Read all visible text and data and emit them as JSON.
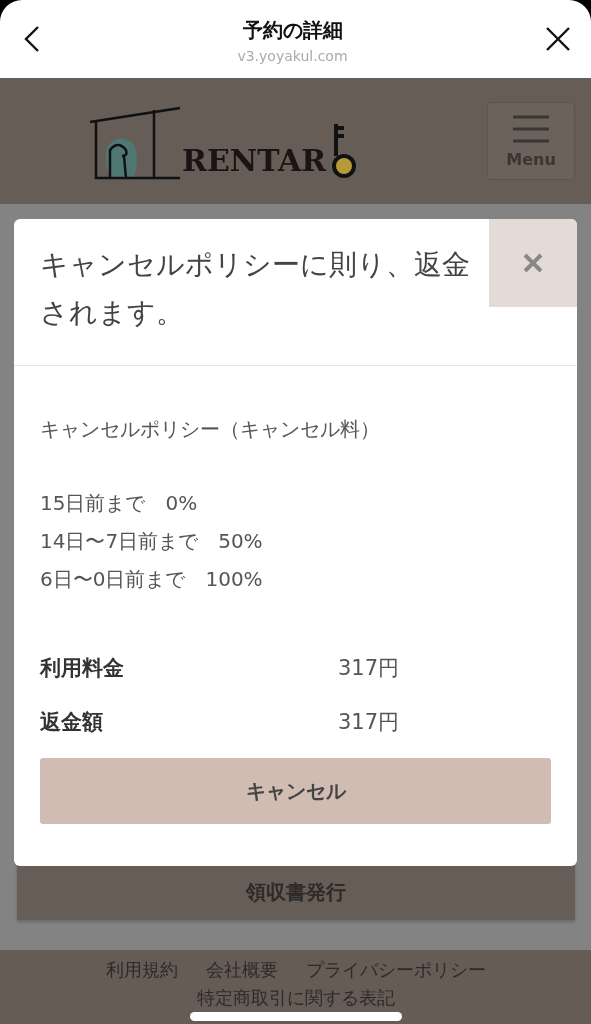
{
  "browser": {
    "title": "予約の詳細",
    "url": "v3.yoyakul.com"
  },
  "site_header": {
    "logo_text": "RENTAR",
    "menu_label": "Menu"
  },
  "modal": {
    "title": "キャンセルポリシーに則り、返金されます。",
    "policy_heading": "キャンセルポリシー（キャンセル料）",
    "policy_lines": [
      "15日前まで　0%",
      "14日〜7日前まで　50%",
      "6日〜0日前まで　100%"
    ],
    "amounts": [
      {
        "label": "利用料金",
        "value": "317円"
      },
      {
        "label": "返金額",
        "value": "317円"
      }
    ],
    "button": "キャンセル"
  },
  "page_button": "領収書発行",
  "footer_links": [
    "利用規約",
    "会社概要",
    "プライバシーポリシー",
    "特定商取引に関する表記"
  ]
}
